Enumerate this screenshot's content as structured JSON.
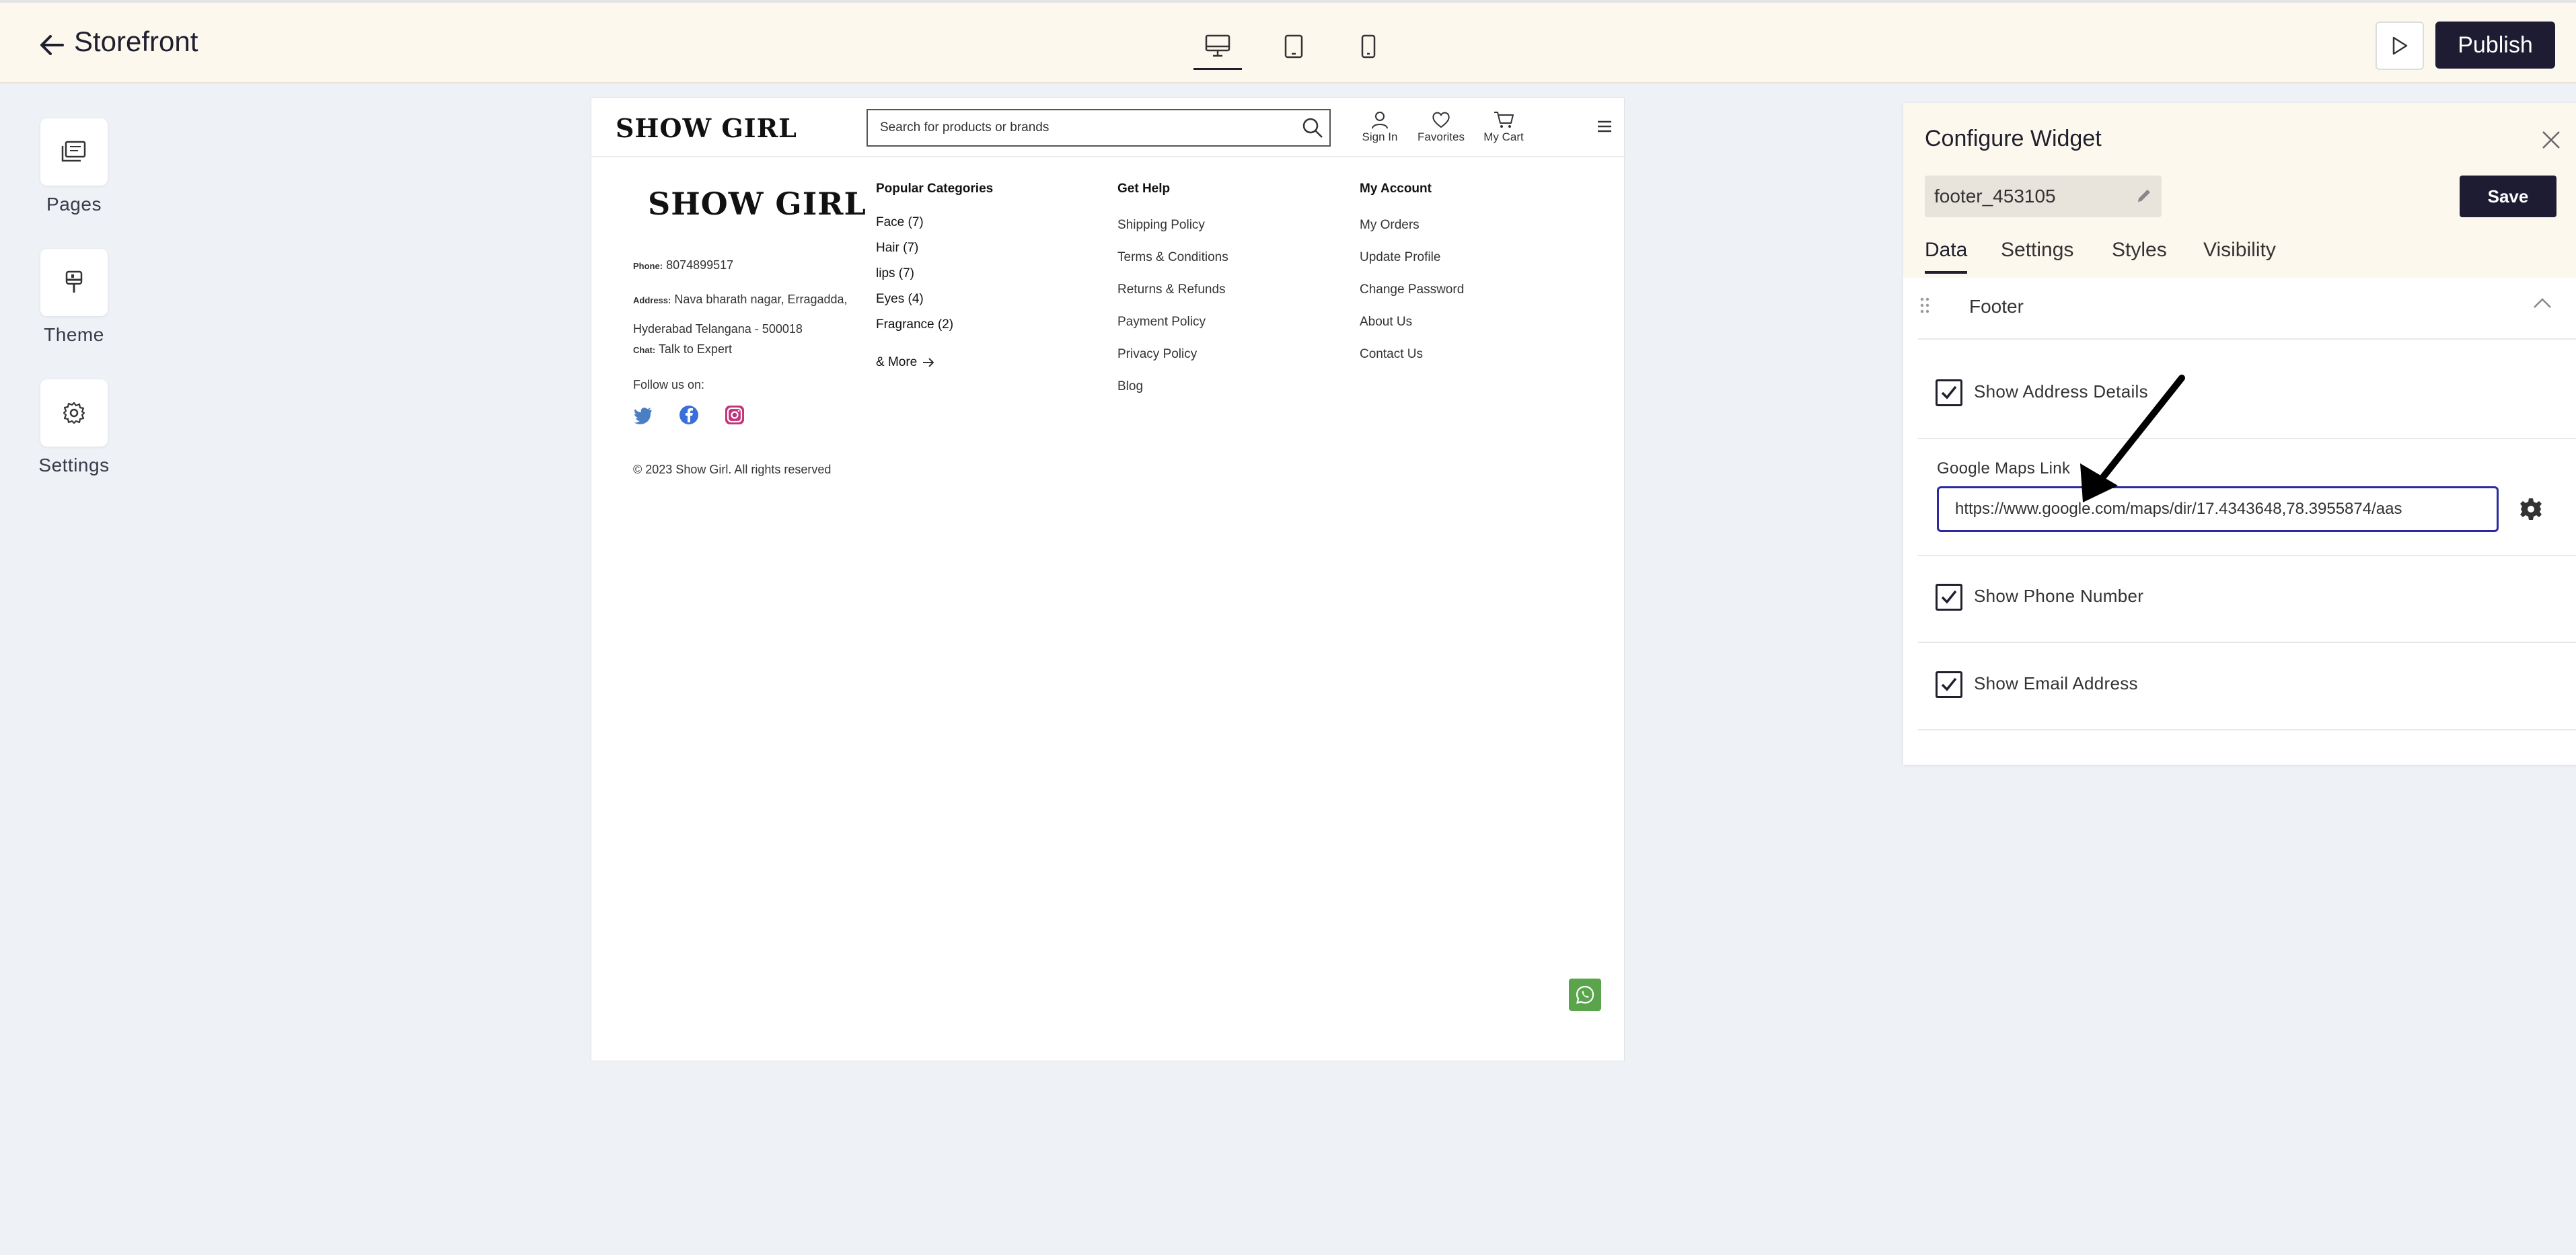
{
  "topbar": {
    "title": "Storefront",
    "publish_label": "Publish",
    "devices": [
      "desktop-icon",
      "tablet-icon",
      "mobile-icon"
    ]
  },
  "rail": {
    "items": [
      {
        "label": "Pages",
        "icon": "pages-icon"
      },
      {
        "label": "Theme",
        "icon": "theme-icon"
      },
      {
        "label": "Settings",
        "icon": "gear-icon"
      }
    ]
  },
  "site": {
    "logo": "SHOW GIRL",
    "search_placeholder": "Search for products or brands",
    "header_actions": [
      "Sign In",
      "Favorites",
      "My Cart"
    ],
    "footer": {
      "logo": "SHOW GIRL",
      "phone_label": "Phone:",
      "phone": "8074899517",
      "address_label": "Address:",
      "address_line1": "Nava bharath nagar, Erragadda,",
      "address_line2": "Hyderabad Telangana - 500018",
      "chat_label": "Chat:",
      "chat": "Talk to Expert",
      "follow": "Follow us on:",
      "copyright": "© 2023 Show Girl. All rights reserved",
      "categories_title": "Popular Categories",
      "categories": [
        "Face (7)",
        "Hair (7)",
        "lips (7)",
        "Eyes (4)",
        "Fragrance (2)"
      ],
      "more": "& More",
      "help_title": "Get Help",
      "help_links": [
        "Shipping Policy",
        "Terms & Conditions",
        "Returns & Refunds",
        "Payment Policy",
        "Privacy Policy",
        "Blog"
      ],
      "account_title": "My Account",
      "account_links": [
        "My Orders",
        "Update Profile",
        "Change Password",
        "About Us",
        "Contact Us"
      ]
    }
  },
  "panel": {
    "title": "Configure Widget",
    "widget_id": "footer_453105",
    "save_label": "Save",
    "tabs": [
      "Data",
      "Settings",
      "Styles",
      "Visibility"
    ],
    "section_title": "Footer",
    "show_address": "Show Address Details",
    "maps_label": "Google Maps Link",
    "maps_value": "https://www.google.com/maps/dir/17.4343648,78.3955874/aas",
    "show_phone": "Show Phone Number",
    "show_email": "Show Email Address"
  },
  "colors": {
    "accent_dark": "#1e1c32",
    "topbar_bg": "#fdf8ee",
    "whatsapp": "#5aa44b",
    "input_focus": "#2b2a9e"
  }
}
